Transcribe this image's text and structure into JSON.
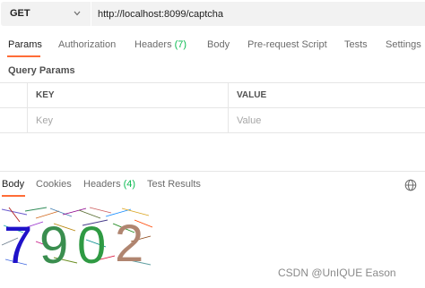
{
  "request": {
    "method": "GET",
    "url": "http://localhost:8099/captcha"
  },
  "request_tabs": [
    {
      "label": "Params",
      "active": true
    },
    {
      "label": "Authorization"
    },
    {
      "label": "Headers",
      "count": "(7)"
    },
    {
      "label": "Body"
    },
    {
      "label": "Pre-request Script"
    },
    {
      "label": "Tests"
    },
    {
      "label": "Settings"
    }
  ],
  "query_params": {
    "title": "Query Params",
    "columns": [
      "KEY",
      "VALUE"
    ],
    "rows": [
      {
        "key_placeholder": "Key",
        "value_placeholder": "Value"
      }
    ]
  },
  "response_tabs": [
    {
      "label": "Body",
      "active": true
    },
    {
      "label": "Cookies"
    },
    {
      "label": "Headers",
      "count": "(4)"
    },
    {
      "label": "Test Results"
    }
  ],
  "response": {
    "captcha_digits": [
      {
        "char": "7",
        "color": "#1f12c9"
      },
      {
        "char": "9",
        "color": "#3a8e4f"
      },
      {
        "char": "0",
        "color": "#2f9a43"
      },
      {
        "char": "2",
        "color": "#b08570"
      }
    ]
  },
  "icons": {
    "method_dropdown": "chevron-down-icon",
    "response_format": "globe-icon"
  },
  "colors": {
    "accent": "#ff6c37",
    "count": "#0cbb52"
  },
  "watermark": "CSDN @UnIQUE Eason"
}
